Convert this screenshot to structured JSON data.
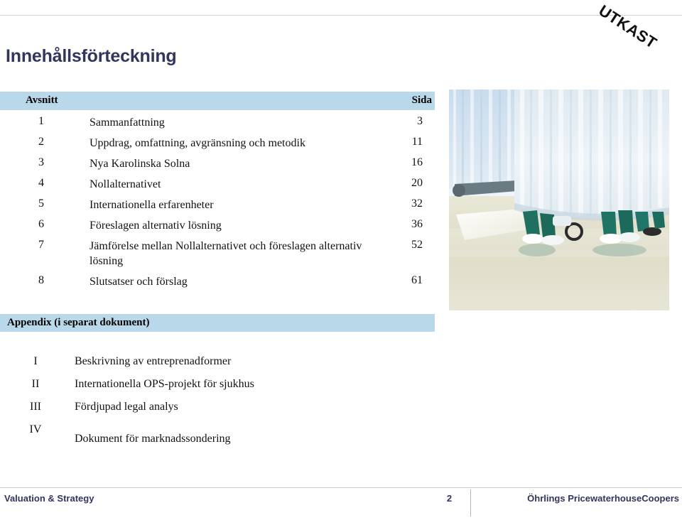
{
  "watermark": {
    "text": "UTKAST"
  },
  "page_title": "Innehållsförteckning",
  "toc": {
    "header": {
      "section_label": "Avsnitt",
      "page_label": "Sida"
    },
    "rows": [
      {
        "num": "1",
        "title": "Sammanfattning",
        "page": "3"
      },
      {
        "num": "2",
        "title": "Uppdrag, omfattning, avgränsning  och metodik",
        "page": "11"
      },
      {
        "num": "3",
        "title": "Nya Karolinska Solna",
        "page": "16"
      },
      {
        "num": "4",
        "title": "Nollalternativet",
        "page": "20"
      },
      {
        "num": "5",
        "title": "Internationella erfarenheter",
        "page": "32"
      },
      {
        "num": "6",
        "title": "Föreslagen alternativ lösning",
        "page": "36"
      },
      {
        "num": "7",
        "title": "Jämförelse mellan Nollalternativet och föreslagen alternativ lösning",
        "page": "52"
      },
      {
        "num": "8",
        "title": "Slutsatser och förslag",
        "page": "61"
      }
    ]
  },
  "appendix": {
    "header_label": "Appendix  (i separat dokument)",
    "rows": [
      {
        "num": "I",
        "title": "Beskrivning av entreprenadformer"
      },
      {
        "num": "II",
        "title": "Internationella OPS-projekt för sjukhus"
      },
      {
        "num": "III",
        "title": "Fördjupad legal analys"
      },
      {
        "num": "IV",
        "title": "Dokument för marknadssondering"
      }
    ]
  },
  "photo": {
    "description": "hospital curtain with staff in green scrubs"
  },
  "footer": {
    "left": "Valuation & Strategy",
    "page_number": "2",
    "right": "Öhrlings PricewaterhouseCoopers"
  },
  "colors": {
    "brand_navy": "#32355e",
    "table_header_blue": "#b9d9ea",
    "rule_gray": "#d4d4d4"
  }
}
